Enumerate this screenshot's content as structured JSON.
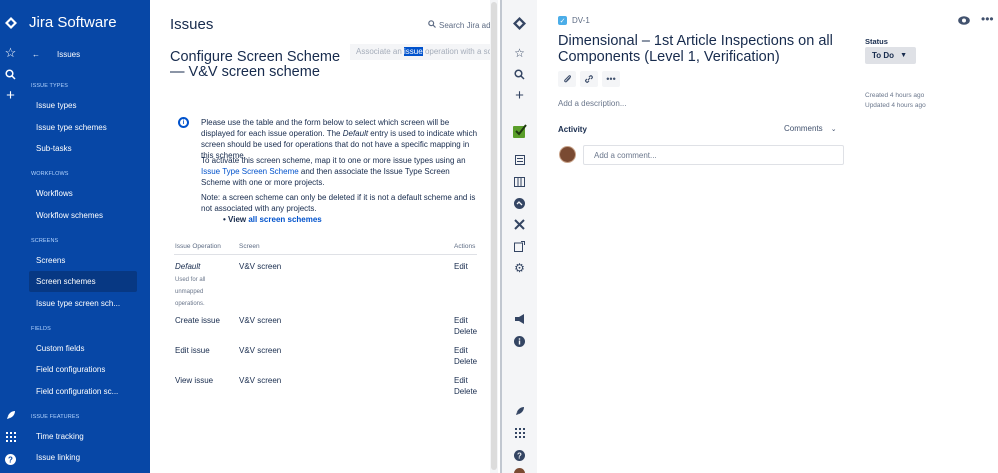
{
  "sidebar": {
    "product": "Jira Software",
    "back_label": "Issues",
    "sections": {
      "issue_types": "ISSUE TYPES",
      "workflows": "WORKFLOWS",
      "screens": "SCREENS",
      "fields": "FIELDS",
      "issue_features": "ISSUE FEATURES"
    },
    "items": [
      {
        "label": "Issue types"
      },
      {
        "label": "Issue type schemes"
      },
      {
        "label": "Sub-tasks"
      },
      {
        "label": "Workflows"
      },
      {
        "label": "Workflow schemes"
      },
      {
        "label": "Screens"
      },
      {
        "label": "Screen schemes"
      },
      {
        "label": "Issue type screen sch..."
      },
      {
        "label": "Custom fields"
      },
      {
        "label": "Field configurations"
      },
      {
        "label": "Field configuration sc..."
      },
      {
        "label": "Time tracking"
      },
      {
        "label": "Issue linking"
      }
    ]
  },
  "main": {
    "title": "Issues",
    "search_label": "Search Jira adm",
    "heading": "Configure Screen Scheme — V&V screen scheme",
    "associate_pre": "Associate an ",
    "associate_hl": "issue",
    "associate_post": " operation with a scree",
    "info": {
      "p1_a": "Please use the table and the form below to select which screen will be displayed for each issue operation. The ",
      "p1_em": "Default",
      "p1_b": " entry is used to indicate which screen should be used for operations that do not have a specific mapping in this scheme.",
      "p2_a": "To activate this screen scheme, map it to one or more issue types using an ",
      "p2_link": "Issue Type Screen Scheme",
      "p2_b": " and then associate the Issue Type Screen Scheme with one or more projects.",
      "p3": "Note: a screen scheme can only be deleted if it is not a default scheme and is not associated with any projects.",
      "view_label": "View ",
      "view_link": "all screen schemes"
    },
    "table": {
      "headers": [
        "Issue Operation",
        "Screen",
        "Actions"
      ],
      "rows": [
        {
          "operation": "Default",
          "note": "Used for all unmapped operations.",
          "screen": "V&V screen",
          "edit": "Edit",
          "delete": ""
        },
        {
          "operation": "Create issue",
          "note": "",
          "screen": "V&V screen",
          "edit": "Edit",
          "delete": "Delete"
        },
        {
          "operation": "Edit issue",
          "note": "",
          "screen": "V&V screen",
          "edit": "Edit",
          "delete": "Delete"
        },
        {
          "operation": "View issue",
          "note": "",
          "screen": "V&V screen",
          "edit": "Edit",
          "delete": "Delete"
        }
      ]
    }
  },
  "issue": {
    "key": "DV-1",
    "title": "Dimensional – 1st Article Inspections on all Components (Level 1, Verification)",
    "description_placeholder": "Add a description...",
    "activity_label": "Activity",
    "comments_label": "Comments",
    "comment_placeholder": "Add a comment...",
    "status_label": "Status",
    "status_value": "To Do",
    "created": "Created 4 hours ago",
    "updated": "Updated 4 hours ago"
  },
  "colors": {
    "nav_blue": "#0747a6",
    "link_blue": "#0052cc",
    "status_grey": "#dfe1e6"
  }
}
